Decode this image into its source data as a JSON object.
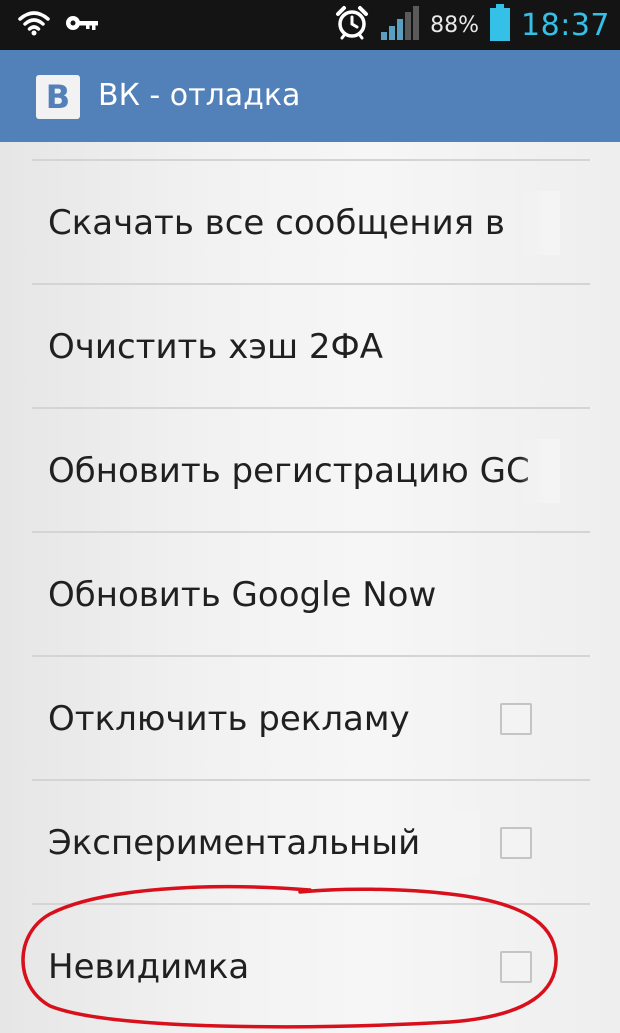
{
  "status_bar": {
    "icons": [
      "wifi-icon",
      "key-icon",
      "alarm-icon",
      "signal-icon",
      "battery-icon"
    ],
    "battery_percent": "88%",
    "time": "18:37",
    "clock_color": "#35c0e8"
  },
  "action_bar": {
    "logo_letter": "В",
    "title": "ВК - отладка",
    "color": "#5181b8"
  },
  "settings": {
    "items": [
      {
        "label": "Скачать все сообщения в",
        "has_checkbox": false,
        "checked": false
      },
      {
        "label": "Очистить хэш 2ФА",
        "has_checkbox": false,
        "checked": false
      },
      {
        "label": "Обновить регистрацию GC",
        "has_checkbox": false,
        "checked": false
      },
      {
        "label": "Обновить Google Now",
        "has_checkbox": false,
        "checked": false
      },
      {
        "label": "Отключить рекламу",
        "has_checkbox": true,
        "checked": false
      },
      {
        "label": "Экспериментальный",
        "has_checkbox": true,
        "checked": false
      },
      {
        "label": "Невидимка",
        "has_checkbox": true,
        "checked": false,
        "highlighted": true
      }
    ]
  },
  "annotation": {
    "highlight_color": "#d8101c"
  }
}
